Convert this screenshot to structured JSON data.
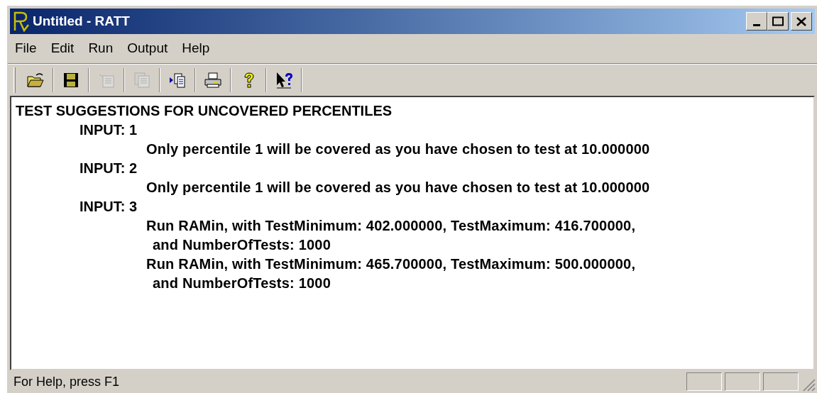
{
  "window": {
    "title": "Untitled - RATT"
  },
  "menu": [
    {
      "label": "File"
    },
    {
      "label": "Edit"
    },
    {
      "label": "Run"
    },
    {
      "label": "Output"
    },
    {
      "label": "Help"
    }
  ],
  "toolbar": [
    {
      "kind": "open",
      "disabled": false
    },
    {
      "kind": "save",
      "disabled": false
    },
    {
      "kind": "copy",
      "disabled": true
    },
    {
      "kind": "paste",
      "disabled": true
    },
    {
      "kind": "import",
      "disabled": false
    },
    {
      "kind": "print",
      "disabled": false
    },
    {
      "kind": "help",
      "disabled": false
    },
    {
      "kind": "context-help",
      "disabled": false
    }
  ],
  "document": {
    "heading": "TEST SUGGESTIONS FOR UNCOVERED PERCENTILES",
    "sections": [
      {
        "label": "INPUT: 1",
        "messages": [
          {
            "lines": [
              "Only percentile 1 will be covered as you have chosen to test at 10.000000"
            ]
          }
        ]
      },
      {
        "label": "INPUT: 2",
        "messages": [
          {
            "lines": [
              "Only percentile 1 will be covered as you have chosen to test at 10.000000"
            ]
          }
        ]
      },
      {
        "label": "INPUT: 3",
        "messages": [
          {
            "lines": [
              "Run RAMin, with TestMinimum: 402.000000, TestMaximum: 416.700000,",
              "and NumberOfTests: 1000"
            ]
          },
          {
            "lines": [
              "Run RAMin, with TestMinimum: 465.700000, TestMaximum: 500.000000,",
              "and NumberOfTests: 1000"
            ]
          }
        ]
      }
    ]
  },
  "status_bar": {
    "text": "For Help, press F1"
  }
}
